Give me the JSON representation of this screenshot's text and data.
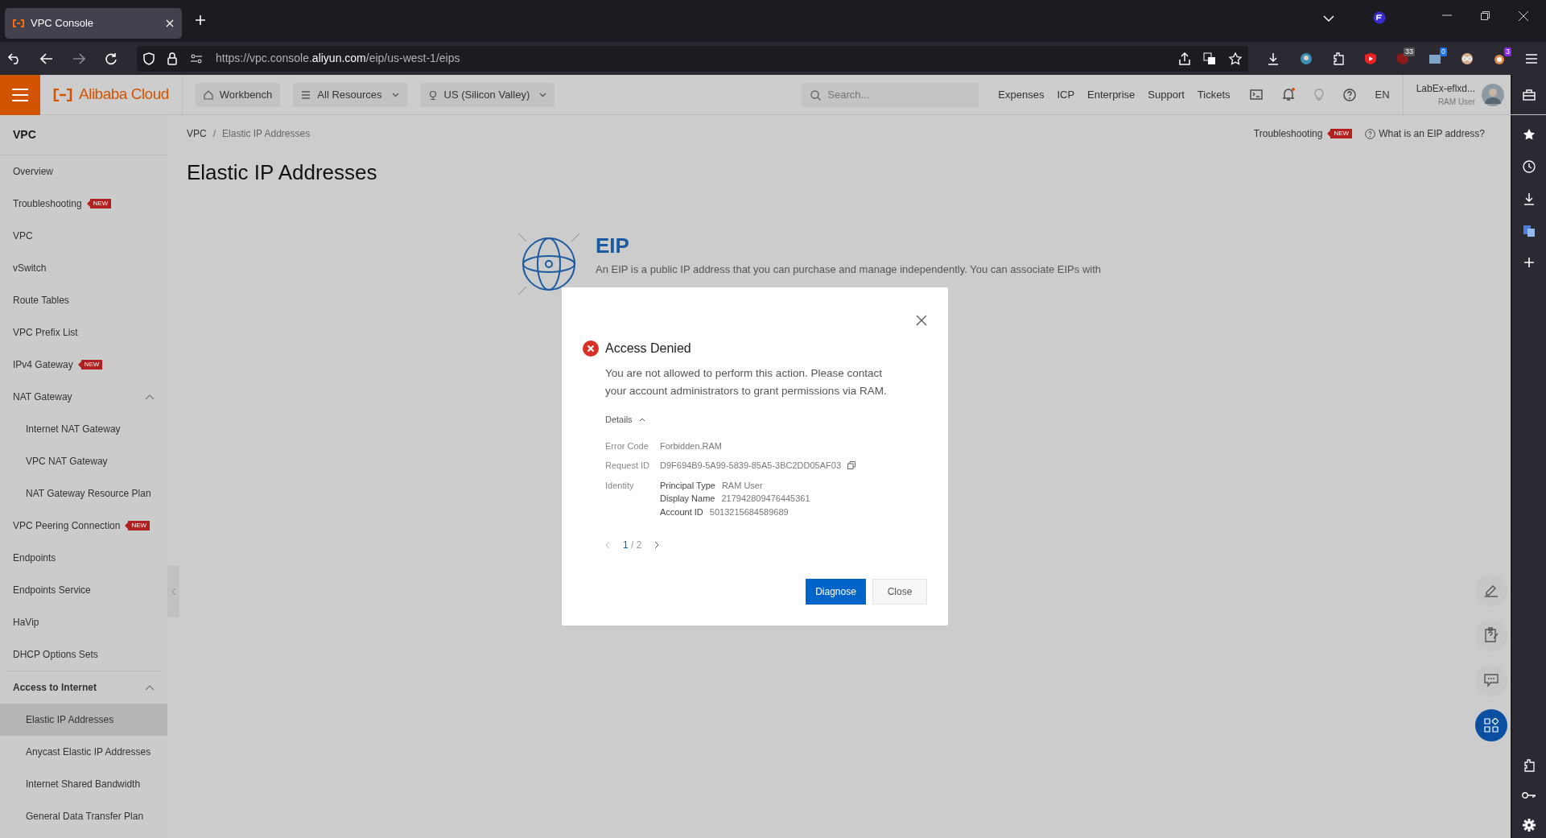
{
  "browser": {
    "tab_title": "VPC Console",
    "url": {
      "prefix": "https://vpc.console.",
      "domain": "aliyun.com",
      "suffix": "/eip/us-west-1/eips"
    },
    "extension_badges": [
      "33",
      "0",
      "3"
    ]
  },
  "header": {
    "logo": "Alibaba Cloud",
    "menus": [
      {
        "kind": "home",
        "label": "Workbench"
      },
      {
        "kind": "list",
        "label": "All Resources"
      },
      {
        "kind": "pin",
        "label": "US (Silicon Valley)"
      }
    ],
    "search": {
      "placeholder": "Search..."
    },
    "links": [
      "Expenses",
      "ICP",
      "Enterprise",
      "Support",
      "Tickets"
    ],
    "language": "EN",
    "user": {
      "name": "LabEx-eflxd...",
      "role": "RAM User"
    }
  },
  "sidebar": {
    "title": "VPC",
    "items": [
      {
        "label": "Overview",
        "selected": false
      },
      {
        "label": "Troubleshooting",
        "badge": "NEW",
        "selected": false
      },
      {
        "label": "VPC",
        "selected": false
      },
      {
        "label": "vSwitch",
        "selected": false
      },
      {
        "label": "Route Tables",
        "selected": false
      },
      {
        "label": "VPC Prefix List",
        "selected": false
      },
      {
        "label": "IPv4 Gateway",
        "badge": "NEW",
        "selected": false
      },
      {
        "label": "NAT Gateway",
        "expanded": true,
        "children": [
          {
            "label": "Internet NAT Gateway",
            "selected": false
          },
          {
            "label": "VPC NAT Gateway",
            "selected": false
          },
          {
            "label": "NAT Gateway Resource Plan",
            "selected": false
          }
        ]
      },
      {
        "label": "VPC Peering Connection",
        "badge": "NEW",
        "selected": false
      },
      {
        "label": "Endpoints",
        "selected": false
      },
      {
        "label": "Endpoints Service",
        "selected": false
      },
      {
        "label": "HaVip",
        "selected": false
      },
      {
        "label": "DHCP Options Sets",
        "selected": false
      }
    ],
    "groups": [
      {
        "label": "Access to Internet",
        "expanded": true,
        "children": [
          {
            "label": "Elastic IP Addresses",
            "selected": true
          },
          {
            "label": "Anycast Elastic IP Addresses",
            "selected": false
          },
          {
            "label": "Internet Shared Bandwidth",
            "selected": false
          },
          {
            "label": "General Data Transfer Plan",
            "selected": false
          }
        ]
      }
    ]
  },
  "page": {
    "breadcrumb": [
      "VPC",
      "Elastic IP Addresses"
    ],
    "breadcrumb_separator": "/",
    "title": "Elastic IP Addresses",
    "troubleshooting": {
      "label": "Troubleshooting",
      "badge": "NEW"
    },
    "help_link": "What is an EIP address?"
  },
  "eip": {
    "title": "EIP",
    "description": "An EIP is a public IP address that you can purchase and manage independently. You can associate EIPs with"
  },
  "modal": {
    "title": "Access Denied",
    "message": "You are not allowed to perform this action. Please contact your account administrators to grant permissions via RAM.",
    "details_label": "Details",
    "details_expanded": true,
    "fields": [
      {
        "label": "Error Code",
        "value": "Forbidden.RAM",
        "copy": false
      },
      {
        "label": "Request ID",
        "value": "D9F694B9-5A99-5839-85A5-3BC2DD05AF03",
        "copy": true
      }
    ],
    "identity": {
      "label": "Identity",
      "entries": [
        {
          "label": "Principal Type",
          "value": "RAM User"
        },
        {
          "label": "Display Name",
          "value": "217942809476445361"
        },
        {
          "label": "Account ID",
          "value": "5013215684589689"
        }
      ]
    },
    "pager": {
      "current": "1",
      "total": "/ 2"
    },
    "buttons": [
      {
        "kind": "primary",
        "label": "Diagnose"
      },
      {
        "kind": "secondary",
        "label": "Close"
      }
    ]
  }
}
